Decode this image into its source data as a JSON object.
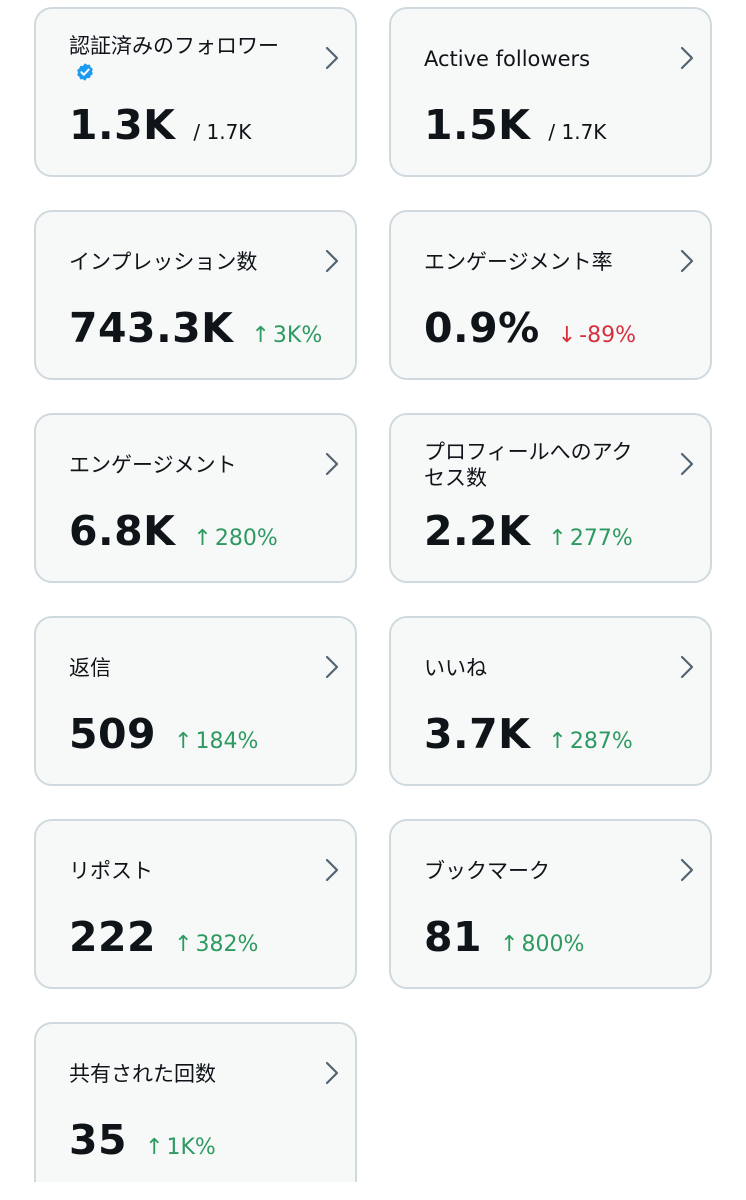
{
  "colors": {
    "card_bg": "#f7f9f9",
    "card_border": "#cfd9de",
    "up": "#2e9a61",
    "down": "#d6303d",
    "verified": "#1d9bf0"
  },
  "cards": [
    {
      "title": "認証済みのフォロワー",
      "value": "1.3K",
      "sub": "/ 1.7K",
      "icon": "verified-badge-icon"
    },
    {
      "title": "Active followers",
      "value": "1.5K",
      "sub": "/ 1.7K"
    },
    {
      "title": "インプレッション数",
      "value": "743.3K",
      "arrow": "↑",
      "change": "3K%",
      "direction": "up"
    },
    {
      "title": "エンゲージメント率",
      "value": "0.9%",
      "arrow": "↓",
      "change": "-89%",
      "direction": "down"
    },
    {
      "title": "エンゲージメント",
      "value": "6.8K",
      "arrow": "↑",
      "change": "280%",
      "direction": "up"
    },
    {
      "title": "プロフィールへのアクセス数",
      "value": "2.2K",
      "arrow": "↑",
      "change": "277%",
      "direction": "up"
    },
    {
      "title": "返信",
      "value": "509",
      "arrow": "↑",
      "change": "184%",
      "direction": "up"
    },
    {
      "title": "いいね",
      "value": "3.7K",
      "arrow": "↑",
      "change": "287%",
      "direction": "up"
    },
    {
      "title": "リポスト",
      "value": "222",
      "arrow": "↑",
      "change": "382%",
      "direction": "up"
    },
    {
      "title": "ブックマーク",
      "value": "81",
      "arrow": "↑",
      "change": "800%",
      "direction": "up"
    },
    {
      "title": "共有された回数",
      "value": "35",
      "arrow": "↑",
      "change": "1K%",
      "direction": "up"
    }
  ]
}
